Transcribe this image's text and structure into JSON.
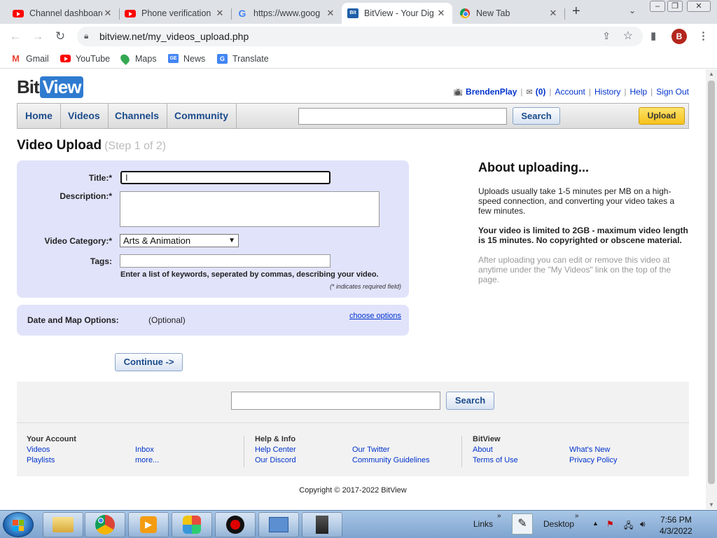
{
  "browser": {
    "tabs": [
      {
        "title": "Channel dashboard",
        "icon": "youtube-icon",
        "active": false
      },
      {
        "title": "Phone verification",
        "icon": "youtube-icon",
        "active": false
      },
      {
        "title": "https://www.goog",
        "icon": "google-icon",
        "active": false
      },
      {
        "title": "BitView - Your Dig",
        "icon": "bitview-icon",
        "active": true
      },
      {
        "title": "New Tab",
        "icon": "chrome-icon",
        "active": false
      }
    ],
    "url": "bitview.net/my_videos_upload.php",
    "profile_initial": "B",
    "bookmarks": [
      {
        "label": "Gmail",
        "icon": "gmail-icon"
      },
      {
        "label": "YouTube",
        "icon": "youtube-icon"
      },
      {
        "label": "Maps",
        "icon": "maps-icon"
      },
      {
        "label": "News",
        "icon": "news-icon"
      },
      {
        "label": "Translate",
        "icon": "translate-icon"
      }
    ]
  },
  "site": {
    "logo_bit": "Bit",
    "logo_view": "View",
    "account": {
      "username": "BrendenPlay",
      "inbox_count": "(0)",
      "links": [
        "Account",
        "History",
        "Help",
        "Sign Out"
      ]
    },
    "nav": [
      "Home",
      "Videos",
      "Channels",
      "Community"
    ],
    "search_button": "Search",
    "upload_button": "Upload"
  },
  "upload": {
    "title": "Video Upload",
    "step": "(Step 1 of 2)",
    "fields": {
      "title_label": "Title:*",
      "title_value": "",
      "description_label": "Description:*",
      "description_value": "",
      "category_label": "Video Category:*",
      "category_value": "Arts & Animation",
      "tags_label": "Tags:",
      "tags_value": "",
      "tags_hint": "Enter a list of keywords, seperated by commas, describing your video.",
      "required_note": "(* indicates required field)"
    },
    "options": {
      "label": "Date and Map Options:",
      "optional": "(Optional)",
      "link": "choose options"
    },
    "continue_button": "Continue ->"
  },
  "about": {
    "heading": "About uploading...",
    "p1": "Uploads usually take 1-5 minutes per MB on a high-speed connection, and converting your video takes a few minutes.",
    "p2": "Your video is limited to 2GB - maximum video length is 15 minutes. No copyrighted or obscene material.",
    "p3": "After uploading you can edit or remove this video at anytime under the \"My Videos\" link on the top of the page."
  },
  "footer": {
    "search_button": "Search",
    "your_account": {
      "heading": "Your Account",
      "links": [
        "Videos",
        "Playlists",
        "Inbox",
        "more..."
      ]
    },
    "help_info": {
      "heading": "Help & Info",
      "links": [
        "Help Center",
        "Our Discord",
        "Our Twitter",
        "Community Guidelines"
      ]
    },
    "bitview": {
      "heading": "BitView",
      "links": [
        "About",
        "Terms of Use",
        "What's New",
        "Privacy Policy"
      ]
    },
    "copyright": "Copyright © 2017-2022 BitView"
  },
  "taskbar": {
    "links_label": "Links",
    "desktop_label": "Desktop",
    "time": "7:56 PM",
    "date": "4/3/2022"
  }
}
